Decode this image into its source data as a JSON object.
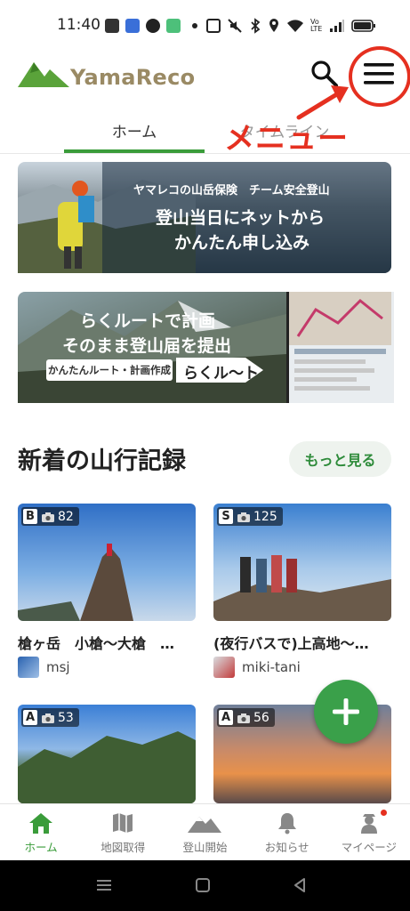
{
  "status_bar": {
    "time": "11:40"
  },
  "header": {
    "logo_text": "YamaReco"
  },
  "tabs": [
    {
      "label": "ホーム",
      "active": true
    },
    {
      "label": "タイムライン",
      "active": false
    }
  ],
  "annotation": {
    "label": "メニュー",
    "color": "#e53020"
  },
  "banners": {
    "insurance": {
      "small": "ヤマレコの山岳保険　チーム安全登山",
      "line1": "登山当日にネットから",
      "line2": "かんたん申し込み"
    },
    "route": {
      "line1": "らくルートで計画",
      "line2": "そのまま登山届を提出",
      "pill": "かんたんルート・計画作成",
      "arrow": "らくル〜ト"
    }
  },
  "section": {
    "title": "新着の山行記録",
    "more_label": "もっと見る"
  },
  "records": [
    {
      "grade": "B",
      "photos": "82",
      "title": "槍ヶ岳　小槍〜大槍　…",
      "user": "msj"
    },
    {
      "grade": "S",
      "photos": "125",
      "title": "(夜行バスで)上高地〜…",
      "user": "miki-tani"
    },
    {
      "grade": "A",
      "photos": "53",
      "title": "",
      "user": ""
    },
    {
      "grade": "A",
      "photos": "56",
      "title": "",
      "user": ""
    }
  ],
  "bottom_nav": [
    {
      "label": "ホーム",
      "icon": "home-icon",
      "active": true
    },
    {
      "label": "地図取得",
      "icon": "map-icon",
      "active": false
    },
    {
      "label": "登山開始",
      "icon": "mountain-icon",
      "active": false
    },
    {
      "label": "お知らせ",
      "icon": "bell-icon",
      "active": false
    },
    {
      "label": "マイページ",
      "icon": "hiker-icon",
      "active": false
    }
  ],
  "colors": {
    "accent": "#3a9c3a",
    "fab": "#3aa04a",
    "annotation": "#e53020"
  }
}
